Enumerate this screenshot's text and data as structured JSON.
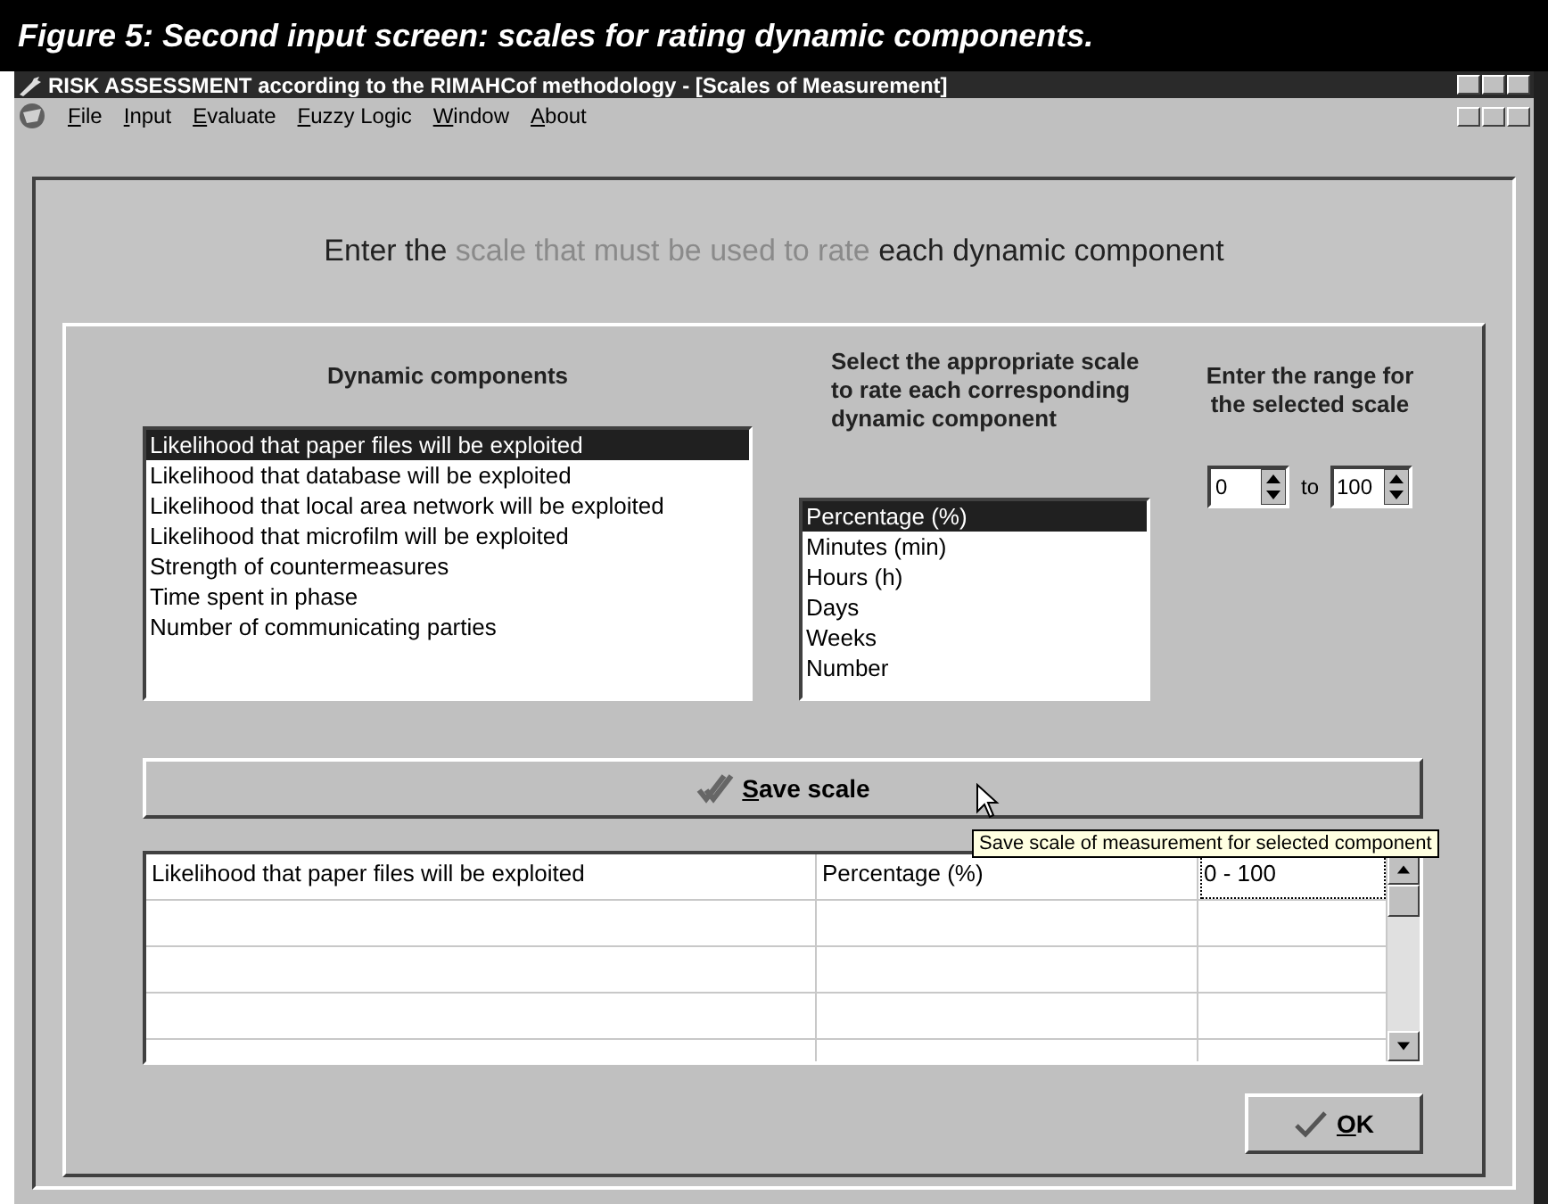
{
  "caption": "Figure 5: Second input screen: scales for rating dynamic components.",
  "window": {
    "title": "RISK ASSESSMENT according to the RIMAHCof methodology - [Scales of Measurement]"
  },
  "menu": [
    "File",
    "Input",
    "Evaluate",
    "Fuzzy Logic",
    "Window",
    "About"
  ],
  "heading": [
    {
      "text": "Enter the ",
      "muted": false
    },
    {
      "text": "scale that must be used to rate",
      "muted": true
    },
    {
      "text": " each dynamic component",
      "muted": false
    }
  ],
  "components": {
    "label": "Dynamic components",
    "items": [
      {
        "text": "Likelihood that paper files will be exploited",
        "selected": true
      },
      {
        "text": "Likelihood that database will be exploited",
        "selected": false
      },
      {
        "text": "Likelihood that local area network will be exploited",
        "selected": false
      },
      {
        "text": "Likelihood that microfilm will be exploited",
        "selected": false
      },
      {
        "text": "Strength of countermeasures",
        "selected": false
      },
      {
        "text": "Time spent in phase",
        "selected": false
      },
      {
        "text": "Number of communicating parties",
        "selected": false
      }
    ]
  },
  "scales": {
    "label": "Select the appropriate scale to rate each corresponding dynamic component",
    "items": [
      {
        "text": "Percentage (%)",
        "selected": true
      },
      {
        "text": "Minutes (min)",
        "selected": false
      },
      {
        "text": "Hours (h)",
        "selected": false
      },
      {
        "text": "Days",
        "selected": false
      },
      {
        "text": "Weeks",
        "selected": false
      },
      {
        "text": "Number",
        "selected": false
      }
    ]
  },
  "range": {
    "label": "Enter the range for the selected scale",
    "from": "0",
    "separator": "to",
    "to": "100"
  },
  "save_button": {
    "label": "Save scale",
    "tooltip": "Save scale of measurement for selected component"
  },
  "table": {
    "rows": [
      {
        "cells": [
          "Likelihood that paper files will be exploited",
          "Percentage (%)",
          "0 - 100"
        ]
      }
    ]
  },
  "ok_button": "OK"
}
